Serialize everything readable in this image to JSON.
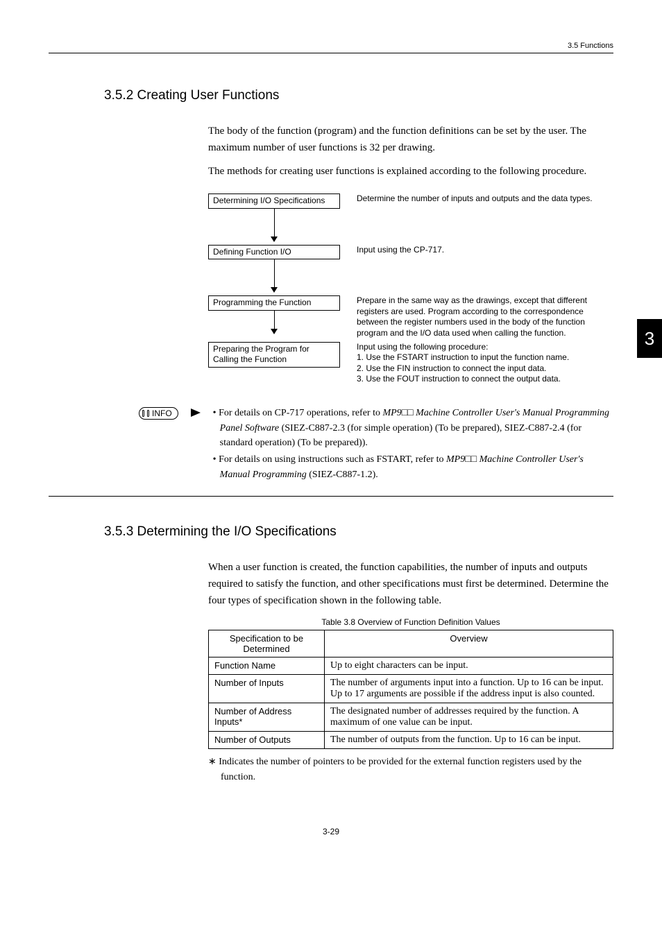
{
  "header": {
    "running": "3.5  Functions"
  },
  "sideTab": "3",
  "section1": {
    "heading": "3.5.2  Creating User Functions",
    "para1": "The body of the function (program) and the function definitions can be set by the user. The maximum number of user functions is 32 per drawing.",
    "para2": "The methods for creating user functions is explained according to the following procedure."
  },
  "flow": {
    "step1": {
      "box": "Determining I/O Specifications",
      "desc": "Determine the number of inputs and outputs and the data types."
    },
    "step2": {
      "box": "Defining Function I/O",
      "desc": "Input using the CP-717."
    },
    "step3": {
      "box": "Programming the Function",
      "desc": "Prepare in the same way as the drawings, except that different registers are used. Program according to the correspondence between the register numbers used in the body of the function program and the I/O data used when calling the function."
    },
    "step4": {
      "box": "Preparing the Program for Calling the Function",
      "desc_intro": "Input using the following procedure:",
      "desc_1": "1. Use the FSTART instruction to input the function name.",
      "desc_2": "2. Use the FIN instruction to connect the input data.",
      "desc_3": "3. Use the FOUT instruction to connect the output data."
    }
  },
  "info": {
    "badge": "INFO",
    "item1_a": "• For details on CP-717 operations, refer to ",
    "item1_i1": "MP9",
    "item1_sq": "□□",
    "item1_i2": " Machine Controller User's Manual Programming Panel Software",
    "item1_b": " (SIEZ-C887-2.3 (for simple operation) (To be prepared), SIEZ-C887-2.4 (for standard operation) (To be prepared)).",
    "item2_a": "• For details on using instructions such as FSTART, refer to ",
    "item2_i1": "MP9",
    "item2_sq": "□□",
    "item2_i2": " Machine Controller User's Manual Programming",
    "item2_b": " (SIEZ-C887-1.2)."
  },
  "section2": {
    "heading": "3.5.3  Determining the I/O Specifications",
    "para1": "When a user function is created, the function capabilities, the number of inputs and outputs required to satisfy the function, and other specifications must first be determined. Determine the four types of specification shown in the following table."
  },
  "table": {
    "caption": "Table 3.8  Overview of Function Definition Values",
    "head": {
      "c1": "Specification to be Determined",
      "c2": "Overview"
    },
    "r1": {
      "c1": "Function Name",
      "c2": "Up to eight characters can be input."
    },
    "r2": {
      "c1": "Number of Inputs",
      "c2a": "The number of arguments input into a function. Up to 16 can be input.",
      "c2b": "Up to 17 arguments are possible if the address input is also counted."
    },
    "r3": {
      "c1": "Number of Address Inputs*",
      "c2": "The designated number of addresses required by the function. A maximum of one value can be input."
    },
    "r4": {
      "c1": "Number of Outputs",
      "c2": "The number of outputs from the function. Up to 16 can be input."
    }
  },
  "footnote": "∗  Indicates the number of pointers to be provided for the external function registers used by the function.",
  "pageNumber": "3-29"
}
